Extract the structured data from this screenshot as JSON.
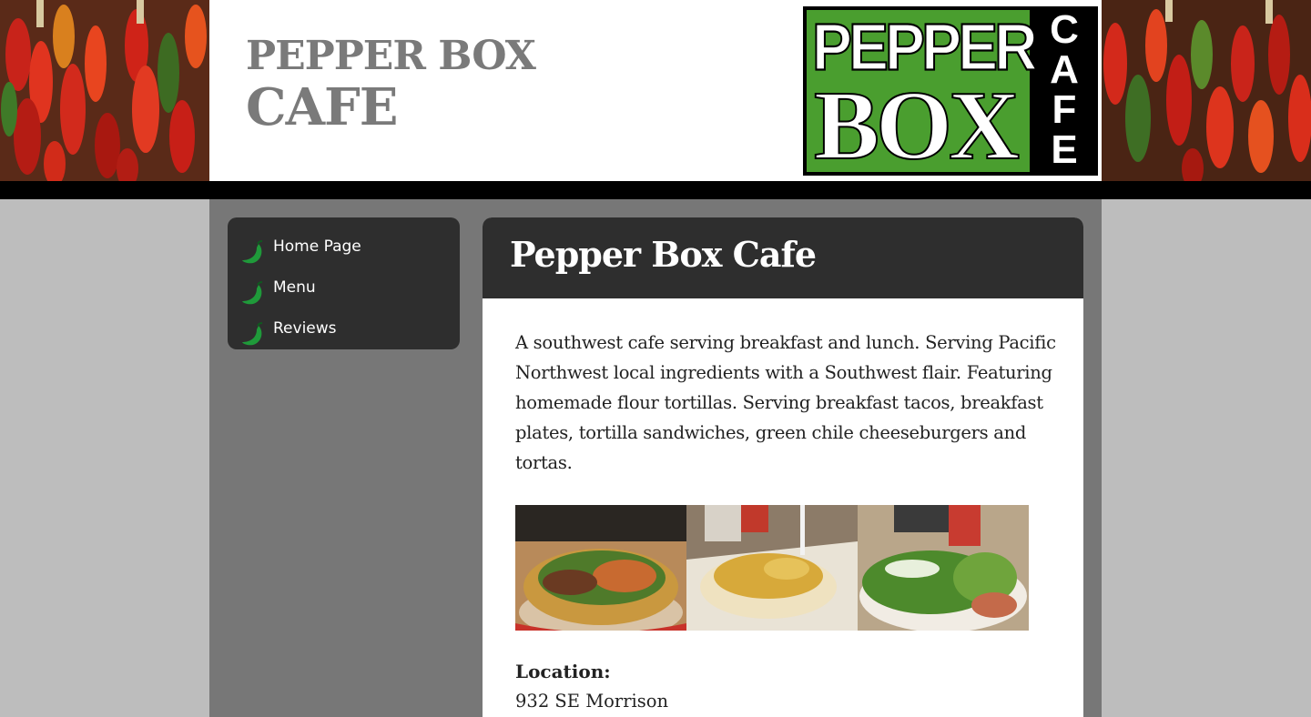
{
  "site": {
    "title_line1": "PEPPER BOX",
    "title_line2": "CAFE"
  },
  "logo": {
    "word1": "PEPPER",
    "word2": "BOX",
    "side_letters": [
      "C",
      "A",
      "F",
      "E"
    ],
    "green": "#4a9e2f"
  },
  "nav": {
    "items": [
      {
        "label": "Home Page",
        "icon": "chile-pepper-icon"
      },
      {
        "label": "Menu",
        "icon": "chile-pepper-icon"
      },
      {
        "label": "Reviews",
        "icon": "chile-pepper-icon"
      }
    ]
  },
  "main": {
    "heading": "Pepper Box Cafe",
    "intro": "A southwest cafe serving breakfast and lunch. Serving Pacific Northwest local ingredients with a Southwest flair. Featuring homemade flour tortillas. Serving breakfast tacos, breakfast plates, tortilla sandwiches, green chile cheeseburgers and tortas.",
    "location_label": "Location:",
    "address": "932 SE Morrison"
  },
  "colors": {
    "page_bg": "#bdbdbd",
    "column_bg": "#777777",
    "panel_dark": "#2e2e2e",
    "icon_green": "#1f9a3a"
  }
}
